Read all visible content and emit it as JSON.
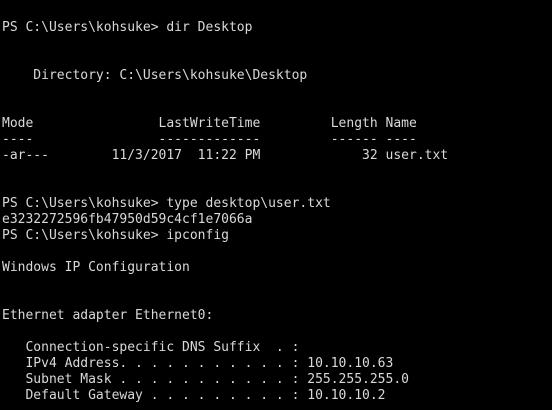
{
  "terminal": {
    "lines": [
      "PS C:\\Users\\kohsuke> dir Desktop",
      "",
      "",
      "    Directory: C:\\Users\\kohsuke\\Desktop",
      "",
      "",
      "Mode                LastWriteTime         Length Name",
      "----                -------------         ------ ----",
      "-ar---        11/3/2017  11:22 PM             32 user.txt",
      "",
      "",
      "PS C:\\Users\\kohsuke> type desktop\\user.txt",
      "e3232272596fb47950d59c4cf1e7066a",
      "PS C:\\Users\\kohsuke> ipconfig",
      "",
      "Windows IP Configuration",
      "",
      "",
      "Ethernet adapter Ethernet0:",
      "",
      "   Connection-specific DNS Suffix  . :",
      "   IPv4 Address. . . . . . . . . . . : 10.10.10.63",
      "   Subnet Mask . . . . . . . . . . . : 255.255.255.0",
      "   Default Gateway . . . . . . . . . : 10.10.10.2"
    ]
  }
}
